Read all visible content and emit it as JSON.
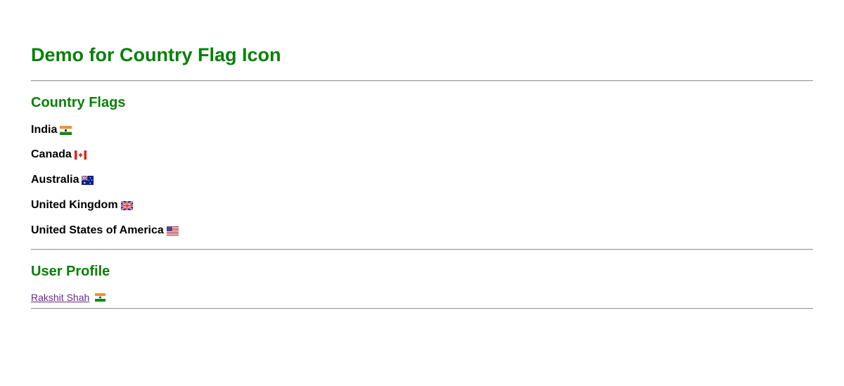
{
  "page": {
    "title": "Demo for Country Flag Icon"
  },
  "countries_section": {
    "heading": "Country Flags",
    "items": [
      {
        "label": "India",
        "flag_icon": "india-flag-icon"
      },
      {
        "label": "Canada",
        "flag_icon": "canada-flag-icon"
      },
      {
        "label": "Australia",
        "flag_icon": "australia-flag-icon"
      },
      {
        "label": "United Kingdom",
        "flag_icon": "united-kingdom-flag-icon"
      },
      {
        "label": "United States of America",
        "flag_icon": "usa-flag-icon"
      }
    ]
  },
  "profile_section": {
    "heading": "User Profile",
    "user_name": "Rakshit Shah",
    "flag_icon": "india-flag-icon"
  },
  "colors": {
    "heading_green": "#098009",
    "link_purple": "#6a2b8a",
    "text_black": "#000000",
    "rule_gray": "#9a9a9a"
  }
}
